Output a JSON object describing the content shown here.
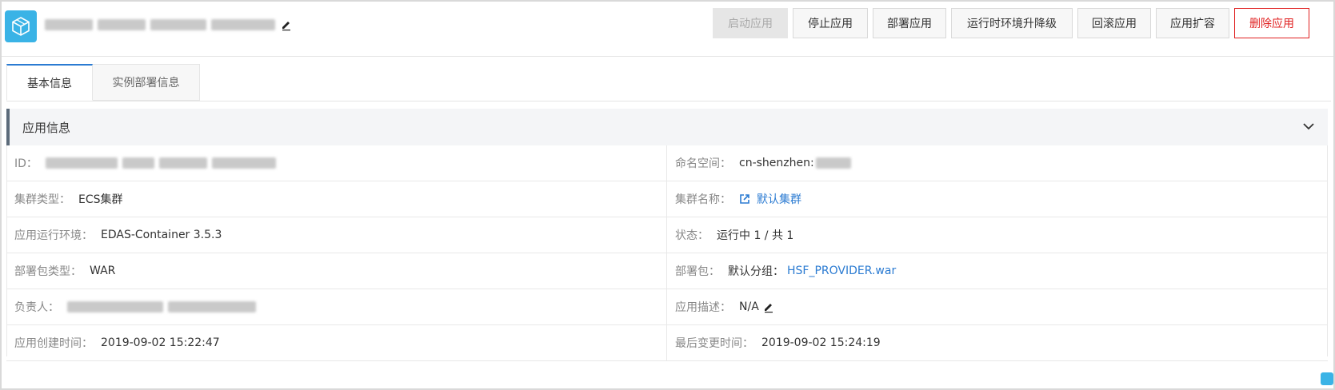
{
  "header": {
    "app_name_hidden": true,
    "icon": "cube-icon",
    "edit_icon": "pencil-icon"
  },
  "actions": [
    {
      "label": "启动应用",
      "state": "disabled"
    },
    {
      "label": "停止应用",
      "state": "normal"
    },
    {
      "label": "部署应用",
      "state": "normal"
    },
    {
      "label": "运行时环境升降级",
      "state": "normal"
    },
    {
      "label": "回滚应用",
      "state": "normal"
    },
    {
      "label": "应用扩容",
      "state": "normal"
    },
    {
      "label": "删除应用",
      "state": "danger"
    }
  ],
  "tabs": [
    {
      "label": "基本信息",
      "active": true
    },
    {
      "label": "实例部署信息",
      "active": false
    }
  ],
  "section": {
    "title": "应用信息"
  },
  "info": {
    "id_label": "ID：",
    "namespace_label": "命名空间：",
    "namespace_value": "cn-shenzhen:",
    "cluster_type_label": "集群类型：",
    "cluster_type_value": "ECS集群",
    "cluster_name_label": "集群名称：",
    "cluster_name_value": "默认集群",
    "runtime_label": "应用运行环境：",
    "runtime_value": "EDAS-Container 3.5.3",
    "status_label": "状态：",
    "status_value": "运行中 1 / 共 1",
    "package_type_label": "部署包类型：",
    "package_type_value": "WAR",
    "package_label": "部署包：",
    "package_group": "默认分组：",
    "package_value": "HSF_PROVIDER.war",
    "owner_label": "负责人：",
    "desc_label": "应用描述：",
    "desc_value": "N/A",
    "created_label": "应用创建时间：",
    "created_value": "2019-09-02 15:22:47",
    "modified_label": "最后变更时间：",
    "modified_value": "2019-09-02 15:24:19"
  },
  "colors": {
    "accent": "#2b7bd2",
    "danger": "#e02020",
    "app_icon": "#3ab3e6"
  }
}
